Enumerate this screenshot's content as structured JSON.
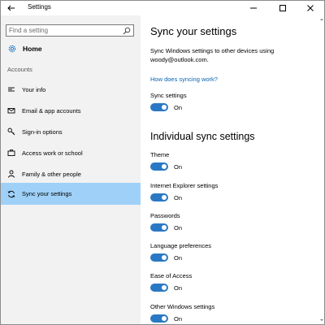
{
  "window": {
    "title": "Settings"
  },
  "sidebar": {
    "search_placeholder": "Find a setting",
    "home_label": "Home",
    "section_label": "Accounts",
    "items": [
      {
        "label": "Your info",
        "icon": "contact-card-icon",
        "active": false
      },
      {
        "label": "Email & app accounts",
        "icon": "email-icon",
        "active": false
      },
      {
        "label": "Sign-in options",
        "icon": "key-icon",
        "active": false
      },
      {
        "label": "Access work or school",
        "icon": "briefcase-icon",
        "active": false
      },
      {
        "label": "Family & other people",
        "icon": "person-icon",
        "active": false
      },
      {
        "label": "Sync your settings",
        "icon": "sync-icon",
        "active": true
      }
    ]
  },
  "main": {
    "title": "Sync your settings",
    "description": "Sync Windows settings to other devices using woody@outlook.com.",
    "link": "How does syncing work?",
    "sync_settings": {
      "label": "Sync settings",
      "state": "On"
    },
    "individual_title": "Individual sync settings",
    "individual": [
      {
        "label": "Theme",
        "state": "On"
      },
      {
        "label": "Internet Explorer settings",
        "state": "On"
      },
      {
        "label": "Passwords",
        "state": "On"
      },
      {
        "label": "Language preferences",
        "state": "On"
      },
      {
        "label": "Ease of Access",
        "state": "On"
      },
      {
        "label": "Other Windows settings",
        "state": "On"
      }
    ]
  },
  "colors": {
    "accent": "#2a78c4",
    "selection": "#9fd1f8",
    "link": "#0a64b4",
    "sidebar_bg": "#f2f2f2"
  }
}
